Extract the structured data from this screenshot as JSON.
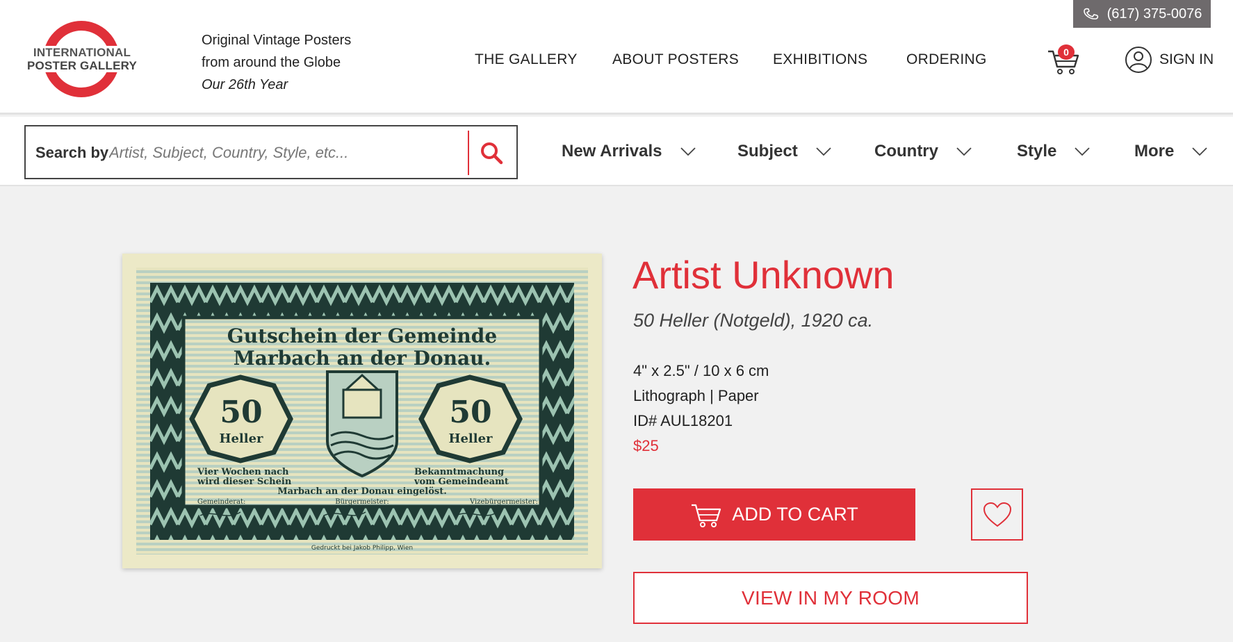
{
  "brand": {
    "logo_line1": "INTERNATIONAL",
    "logo_line2": "POSTER GALLERY",
    "tagline_1": "Original Vintage Posters",
    "tagline_2": "from around the Globe",
    "tagline_3": "Our 26th Year",
    "accent": "#e03039"
  },
  "phone": {
    "number": "(617) 375-0076",
    "icon": "phone-icon"
  },
  "nav": {
    "items": [
      "THE GALLERY",
      "ABOUT POSTERS",
      "EXHIBITIONS",
      "ORDERING"
    ],
    "cart_count": "0",
    "sign_in": "SIGN IN"
  },
  "search": {
    "label": "Search by",
    "placeholder": "Artist, Subject, Country, Style, etc..."
  },
  "filters": [
    "New Arrivals",
    "Subject",
    "Country",
    "Style",
    "More"
  ],
  "product": {
    "artist": "Artist Unknown",
    "title": "50 Heller (Notgeld), 1920 ca.",
    "size": "4\" x 2.5\" / 10 x 6 cm",
    "medium": "Lithograph | Paper",
    "id": "ID# AUL18201",
    "price": "$25",
    "add_to_cart": "ADD TO CART",
    "view_in_room": "VIEW IN MY ROOM",
    "image": {
      "headline_1": "Gutschein der Gemeinde",
      "headline_2": "Marbach an der Donau.",
      "value": "50",
      "unit": "Heller",
      "left_text_1": "Vier Wochen nach",
      "left_text_2": "wird dieser Schein",
      "right_text_1": "Bekanntmachung",
      "right_text_2": "vom Gemeindeamt",
      "center_text": "Marbach an der Donau eingelöst.",
      "sign_left": "Gemeinderat:",
      "sign_center": "Bürgermeister:",
      "sign_right": "Vizebürgermeister:",
      "printer": "Gedruckt bei Jakob Philipp, Wien"
    }
  }
}
